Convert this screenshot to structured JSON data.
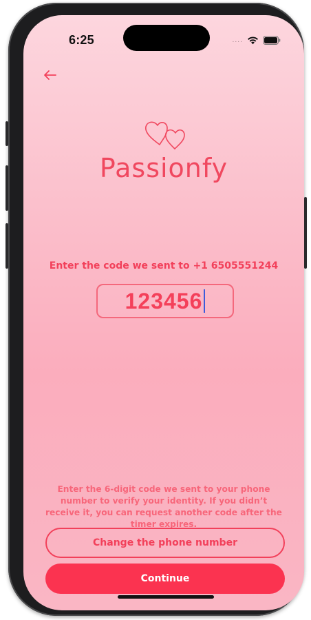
{
  "status_bar": {
    "time": "6:25",
    "signal": "....",
    "wifi_icon": "wifi-icon",
    "battery_icon": "battery-icon"
  },
  "nav": {
    "back_icon": "arrow-left-icon"
  },
  "brand": {
    "logo_icon": "two-hearts-icon",
    "name": "Passionfy"
  },
  "verification": {
    "prompt": "Enter the code we sent to +1 6505551244",
    "code_value": "123456",
    "help_text": "Enter the 6-digit code we sent to your phone number to verify your identity. If you didn’t receive it, you can request another code after the timer expires."
  },
  "actions": {
    "change_phone_label": "Change the phone number",
    "continue_label": "Continue"
  },
  "colors": {
    "accent": "#f2405a",
    "primary_button": "#fb3350",
    "background_top": "#fdd6de",
    "background_bottom": "#fab6c4",
    "caret": "#3b5bdb"
  }
}
